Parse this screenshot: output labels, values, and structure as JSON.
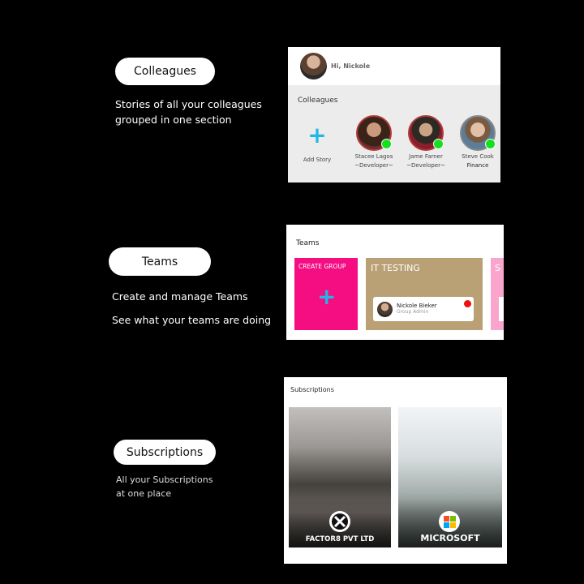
{
  "sections": {
    "colleagues": {
      "pill": "Colleagues",
      "desc": [
        "Stories of all your colleagues",
        "grouped in one section"
      ]
    },
    "teams": {
      "pill": "Teams",
      "desc": [
        "Create and manage Teams",
        "See what your teams are doing"
      ]
    },
    "subscriptions": {
      "pill": "Subscriptions",
      "desc": [
        "All your Subscriptions",
        "at one place"
      ]
    }
  },
  "colleagues_screen": {
    "greeting": "Hi, Nickole",
    "section_label": "Colleagues",
    "add_story_label": "Add Story",
    "stories": [
      {
        "name": "Stacee Lagos",
        "role": "~Developer~"
      },
      {
        "name": "Jame Farner",
        "role": "~Developer~"
      },
      {
        "name": "Steve Cook",
        "role": "Finance"
      }
    ]
  },
  "teams_screen": {
    "title": "Teams",
    "create_label": "CREATE GROUP",
    "team_name": "IT TESTING",
    "admin_name": "Nickole Bieker",
    "admin_role": "Group Admin",
    "third_label": "S"
  },
  "subscriptions_screen": {
    "title": "Subscriptions",
    "items": [
      {
        "name": "FACTOR8 PVT LTD"
      },
      {
        "name": "MICROSOFT"
      }
    ]
  },
  "colors": {
    "create_card": "#f50d82",
    "team_card": "#b9a075",
    "online": "#14e01e",
    "plus": "#1fb8e6"
  }
}
